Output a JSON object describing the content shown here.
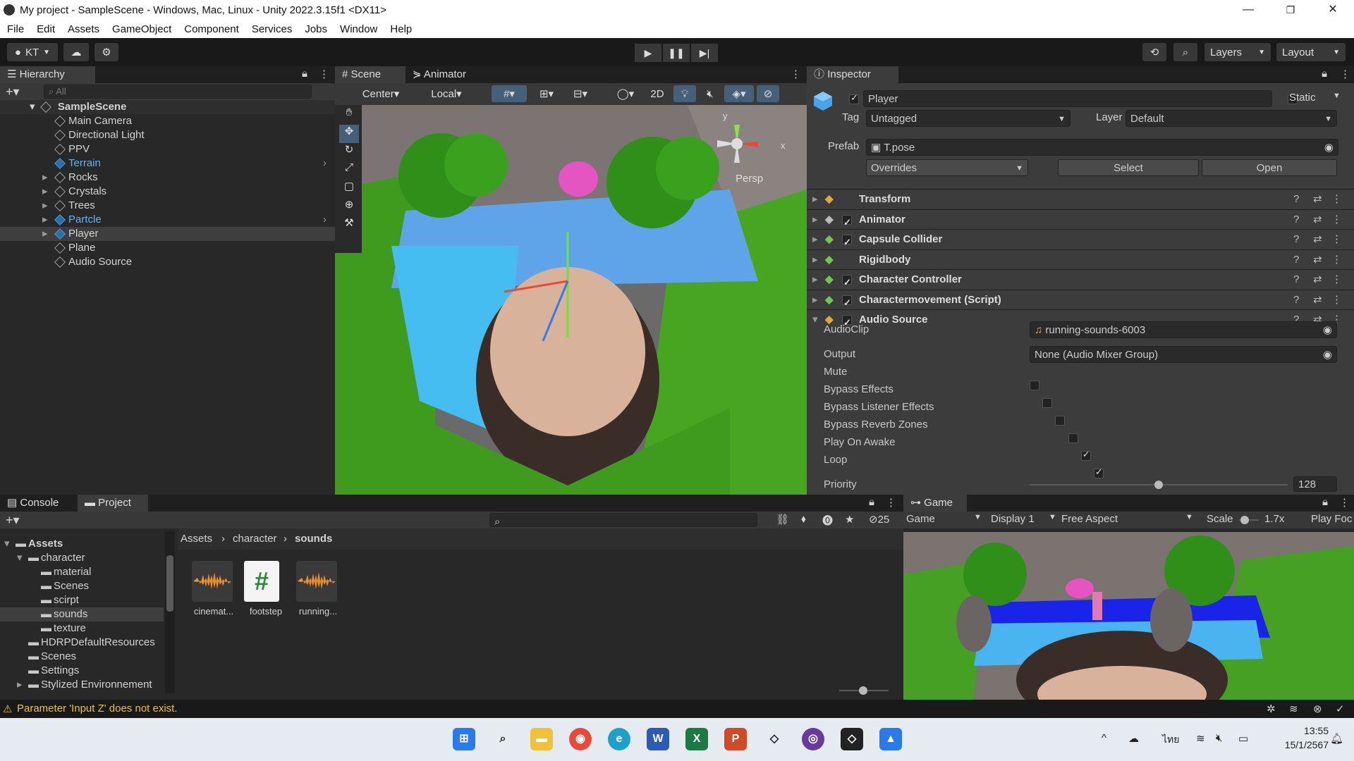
{
  "window": {
    "title": "My project - SampleScene - Windows, Mac, Linux - Unity 2022.3.15f1 <DX11>",
    "minimize": "—",
    "maximize": "❐",
    "close": "✕"
  },
  "menu": [
    "File",
    "Edit",
    "Assets",
    "GameObject",
    "Component",
    "Services",
    "Jobs",
    "Window",
    "Help"
  ],
  "toolbar": {
    "account": "KT",
    "layers": "Layers",
    "layout": "Layout"
  },
  "hierarchy": {
    "tab": "Hierarchy",
    "search_placeholder": "All",
    "scene": "SampleScene",
    "items": [
      {
        "label": "Main Camera",
        "color": "#d2d2d2"
      },
      {
        "label": "Directional Light",
        "color": "#d2d2d2"
      },
      {
        "label": "PPV",
        "color": "#d2d2d2"
      },
      {
        "label": "Terrain",
        "color": "#5fb4f5"
      },
      {
        "label": "Rocks",
        "color": "#d2d2d2"
      },
      {
        "label": "Crystals",
        "color": "#d2d2d2"
      },
      {
        "label": "Trees",
        "color": "#d2d2d2"
      },
      {
        "label": "Partcle",
        "color": "#5fb4f5"
      },
      {
        "label": "Player",
        "color": "#d2d2d2"
      },
      {
        "label": "Plane",
        "color": "#d2d2d2"
      },
      {
        "label": "Audio Source",
        "color": "#d2d2d2"
      }
    ]
  },
  "scene": {
    "tabs": [
      "Scene",
      "Animator"
    ],
    "pivot": "Center",
    "space": "Local",
    "mode_2d": "2D",
    "persp": "Persp",
    "axis_y": "y",
    "axis_x": "x"
  },
  "inspector": {
    "tab": "Inspector",
    "object_name": "Player",
    "static_label": "Static",
    "tag_label": "Tag",
    "tag_value": "Untagged",
    "layer_label": "Layer",
    "layer_value": "Default",
    "prefab_label": "Prefab",
    "prefab_value": "T.pose",
    "overrides": "Overrides",
    "select": "Select",
    "open": "Open",
    "components": [
      "Transform",
      "Animator",
      "Capsule Collider",
      "Rigidbody",
      "Character Controller",
      "Charactermovement (Script)",
      "Audio Source"
    ],
    "audio": {
      "clip_label": "AudioClip",
      "clip_value": "running-sounds-6003",
      "output_label": "Output",
      "output_value": "None (Audio Mixer Group)",
      "mute": "Mute",
      "bypass_effects": "Bypass Effects",
      "bypass_listener": "Bypass Listener Effects",
      "bypass_reverb": "Bypass Reverb Zones",
      "play_on_awake": "Play On Awake",
      "loop": "Loop",
      "priority_label": "Priority",
      "priority_value": "128",
      "priority_fraction": 0.5
    }
  },
  "project": {
    "tabs": [
      "Console",
      "Project"
    ],
    "count": "25",
    "breadcrumb": [
      "Assets",
      "character",
      "sounds"
    ],
    "tree": [
      {
        "label": "Assets",
        "indent": 0,
        "bold": true
      },
      {
        "label": "character",
        "indent": 1,
        "bold": false
      },
      {
        "label": "material",
        "indent": 2,
        "bold": false
      },
      {
        "label": "Scenes",
        "indent": 2,
        "bold": false
      },
      {
        "label": "scirpt",
        "indent": 2,
        "bold": false
      },
      {
        "label": "sounds",
        "indent": 2,
        "bold": false
      },
      {
        "label": "texture",
        "indent": 2,
        "bold": false
      },
      {
        "label": "HDRPDefaultResources",
        "indent": 1,
        "bold": false
      },
      {
        "label": "Scenes",
        "indent": 1,
        "bold": false
      },
      {
        "label": "Settings",
        "indent": 1,
        "bold": false
      },
      {
        "label": "Stylized Environnement",
        "indent": 1,
        "bold": false
      }
    ],
    "assets": [
      {
        "label": "cinemat...",
        "kind": "audio"
      },
      {
        "label": "footstep",
        "kind": "script"
      },
      {
        "label": "running...",
        "kind": "audio"
      }
    ]
  },
  "game": {
    "tab": "Game",
    "view": "Game",
    "display": "Display 1",
    "aspect": "Free Aspect",
    "scale_label": "Scale",
    "scale_value": "1.7x",
    "play_focused": "Play Foc"
  },
  "status": {
    "message": "Parameter 'Input Z' does not exist."
  },
  "taskbar": {
    "time": "13:55",
    "date": "15/1/2567",
    "lang": "ไทย"
  }
}
